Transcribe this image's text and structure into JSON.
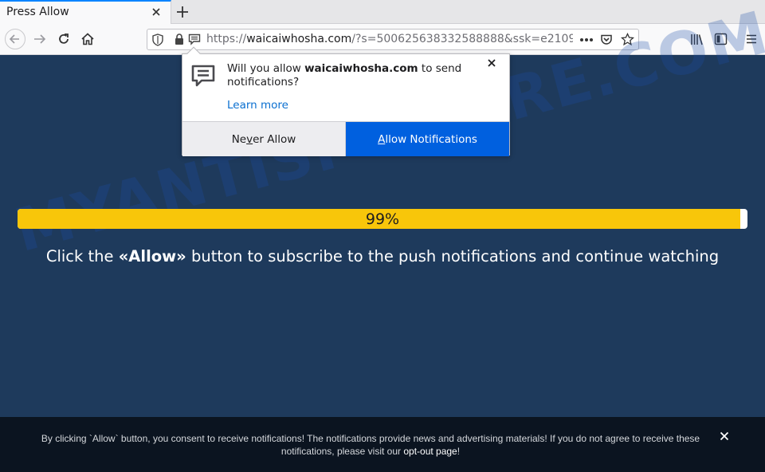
{
  "tab": {
    "title": "Press Allow"
  },
  "navbar": {
    "url_prefix": "https://",
    "url_domain": "waicaiwhosha.com",
    "url_rest": "/?s=500625638332588888&ssk=e2109"
  },
  "popup": {
    "message_pre": "Will you allow ",
    "message_domain": "waicaiwhosha.com",
    "message_post": " to send notifications?",
    "learn_more": "Learn more",
    "never_allow_pre": "Ne",
    "never_allow_key": "v",
    "never_allow_post": "er Allow",
    "allow_key": "A",
    "allow_post": "llow Notifications"
  },
  "page": {
    "watermark": "MYANTISPYWARE.COM",
    "progress_label": "99%",
    "progress_value": 0.99,
    "headline_pre": "Click the ",
    "headline_bold": "«Allow»",
    "headline_post": " button to subscribe to the push notifications and continue watching"
  },
  "consent": {
    "text_main": "By clicking `Allow` button, you consent to receive notifications! The notifications provide news and advertising materials! If you do not agree to receive these notifications, please visit our ",
    "link": "opt-out page",
    "text_end": "!"
  },
  "colors": {
    "page_bg": "#1e3a5c",
    "progress_fill": "#f8c60a",
    "allow_button": "#0060df",
    "consent_bg": "#0b1420"
  }
}
